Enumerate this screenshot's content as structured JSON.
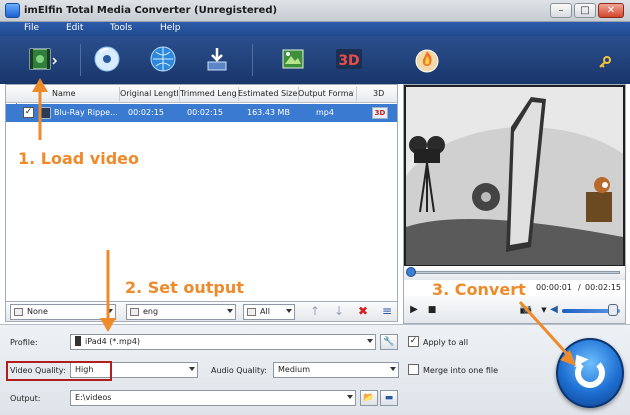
{
  "window": {
    "title": "imElfin Total Media Converter (Unregistered)",
    "minimize_label": "–",
    "maximize_label": "□",
    "close_label": "✕"
  },
  "menu": [
    "File",
    "Edit",
    "Tools",
    "Help"
  ],
  "toolbar": {
    "icons": [
      "add-video-icon",
      "dvd-icon",
      "globe-icon",
      "download-icon",
      "trim-icon",
      "3d-icon",
      "burn-icon"
    ],
    "threed_label": "3D",
    "key_icon": "key-icon"
  },
  "file_table": {
    "columns": [
      "Name",
      "Original Length",
      "Trimmed Length",
      "Estimated Size",
      "Output Format",
      "3D"
    ],
    "rows": [
      {
        "checked": true,
        "name": "Blu-Ray Rippe...",
        "original_length": "00:02:15",
        "trimmed_length": "00:02:15",
        "estimated_size": "163.43 MB",
        "output_format": "mp4",
        "threed": "3D"
      }
    ]
  },
  "controls": {
    "subtitle": "None",
    "audio_track": "eng",
    "effect": "All",
    "up_arrow": "↑",
    "down_arrow": "↓",
    "delete": "✖",
    "list": "≡"
  },
  "preview": {
    "current_time": "00:00:01",
    "total_time": "00:02:15",
    "separator": "/",
    "progress": 0.01,
    "volume": 0.8
  },
  "settings": {
    "profile_label": "Profile:",
    "profile_value": "iPad4 (*.mp4)",
    "apply_to_all_label": "Apply to all",
    "apply_to_all_checked": true,
    "video_quality_label": "Video Quality:",
    "video_quality_value": "High",
    "audio_quality_label": "Audio Quality:",
    "audio_quality_value": "Medium",
    "merge_label": "Merge into one file",
    "merge_checked": false,
    "output_label": "Output:",
    "output_value": "E:\\videos"
  },
  "annotations": {
    "load": "1. Load video",
    "output": "2. Set output",
    "convert": "3. Convert"
  },
  "colors": {
    "annotation": "#ef8a2b",
    "highlight": "#b01e1e",
    "selection": "#3a7ad0",
    "toolbar": "#19366a"
  }
}
